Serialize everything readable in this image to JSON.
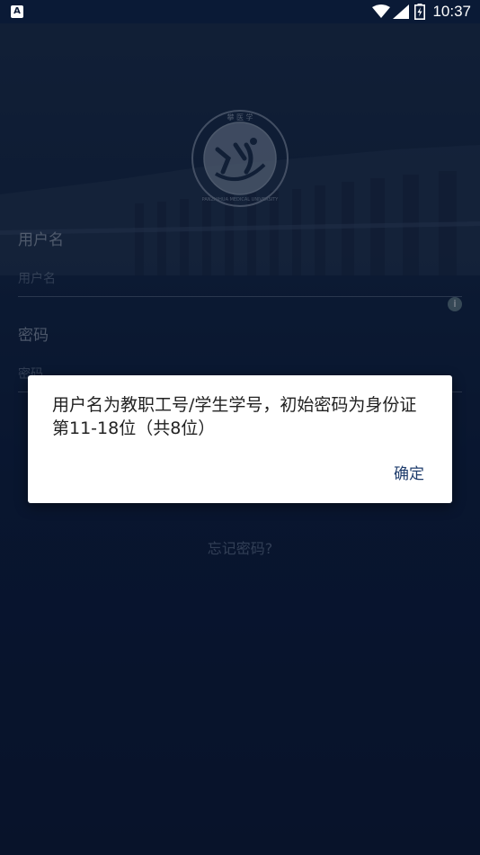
{
  "status_bar": {
    "notification_icon": "A",
    "time": "10:37",
    "icons": [
      "wifi-icon",
      "signal-icon",
      "battery-charging-icon"
    ]
  },
  "login": {
    "username_label": "用户名",
    "username_placeholder": "用户名",
    "password_label": "密码",
    "password_placeholder": "密码",
    "forgot_password": "忘记密码?"
  },
  "logo": {
    "icon": "university-seal-icon",
    "text": "PANZHIHUA MEDICAL UNIVERSITY"
  },
  "dialog": {
    "message": "用户名为教职工号/学生学号，初始密码为身份证第11-18位（共8位）",
    "ok_label": "确定"
  },
  "colors": {
    "background": "#0b1a36",
    "dialog_bg": "#ffffff",
    "accent": "#1f3d6d"
  }
}
